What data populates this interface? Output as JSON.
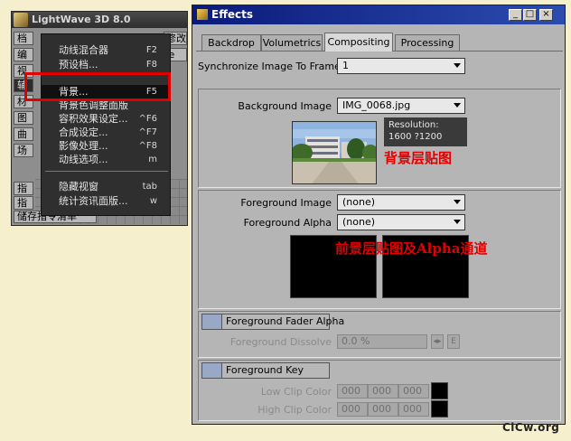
{
  "lw": {
    "title": "LightWave 3D 8.0",
    "top_btn": "修改",
    "drop_btn": "ve",
    "side_buttons": [
      "档",
      "编",
      "视",
      "辅",
      "材",
      "图",
      "曲",
      "场",
      "指",
      "指"
    ],
    "status": "储存指令清单",
    "menu": [
      {
        "label": "动线混合器",
        "shortcut": "F2"
      },
      {
        "label": "预设档...",
        "shortcut": "F8"
      },
      {
        "label": "背景...",
        "shortcut": "F5"
      },
      {
        "label": "背景色调整面版",
        "shortcut": ""
      },
      {
        "label": "容积效果设定...",
        "shortcut": "^F6"
      },
      {
        "label": "合成设定...",
        "shortcut": "^F7"
      },
      {
        "label": "影像处理...",
        "shortcut": "^F8"
      },
      {
        "label": "动线选项...",
        "shortcut": "m"
      },
      {
        "label": "隐藏视窗",
        "shortcut": "tab"
      },
      {
        "label": "统计资讯面版...",
        "shortcut": "w"
      }
    ]
  },
  "fx": {
    "title": "Effects",
    "win_buttons": {
      "minimize": "_",
      "maximize": "□",
      "close": "×"
    },
    "tabs": [
      "Backdrop",
      "Volumetrics",
      "Compositing",
      "Processing"
    ],
    "active_tab": "Compositing",
    "sync_label": "Synchronize Image To Frame",
    "sync_value": "1",
    "bg_image_label": "Background Image",
    "bg_image_value": "IMG_0068.jpg",
    "resolution_label": "Resolution:",
    "resolution_value": "1600 ?1200",
    "bg_annotation": "背景层贴图",
    "fg_image_label": "Foreground Image",
    "fg_image_value": "(none)",
    "fg_alpha_label": "Foreground Alpha",
    "fg_alpha_value": "(none)",
    "fg_annotation": "前景层贴图及Alpha通道",
    "fader_alpha_label": "Foreground Fader Alpha",
    "dissolve_label": "Foreground Dissolve",
    "dissolve_value": "0.0 %",
    "dissolve_env_btn": "E",
    "fg_key_label": "Foreground Key",
    "low_clip_label": "Low Clip Color",
    "high_clip_label": "High Clip Color",
    "low_clip": [
      "000",
      "000",
      "000"
    ],
    "high_clip": [
      "000",
      "000",
      "000"
    ]
  },
  "watermark": "CiCw.org"
}
